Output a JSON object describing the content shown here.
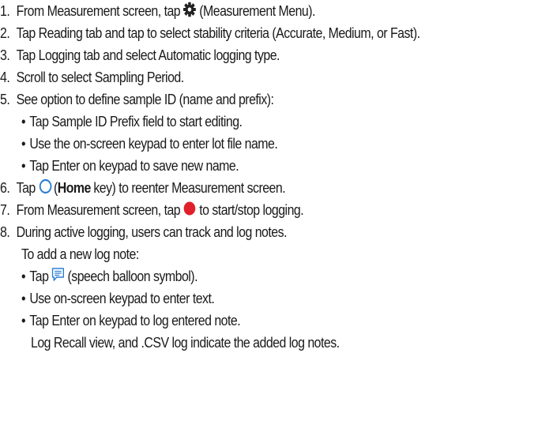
{
  "colors": {
    "text": "#1a1a1a",
    "accent_blue": "#2b7fd4",
    "record_red": "#e0202a",
    "icon_dark": "#222222"
  },
  "icons": {
    "gear": "gear-icon",
    "home": "home-circle-icon",
    "record": "record-dot-icon",
    "note": "speech-balloon-icon"
  },
  "steps": [
    {
      "num": "1.",
      "pre": "From Measurement screen, tap",
      "post": "(Measurement Menu)."
    },
    {
      "num": "2.",
      "text": "Tap Reading tab and tap to select stability criteria (Accurate, Medium, or Fast)."
    },
    {
      "num": "3.",
      "text": "Tap Logging tab and select Automatic logging type."
    },
    {
      "num": "4.",
      "text": "Scroll to select Sampling Period."
    },
    {
      "num": "5.",
      "text": "See option to define sample ID (name and prefix):"
    },
    {
      "num": "6.",
      "pre": "Tap",
      "bold": "Home",
      "post1": "(",
      "post2": "key) to reenter Measurement screen."
    },
    {
      "num": "7.",
      "pre": "From Measurement screen, tap",
      "post": "to start/stop logging."
    },
    {
      "num": "8.",
      "text": "During active logging, users can track and log notes.",
      "cont": "To add a new log note:"
    }
  ],
  "step5_bullets": [
    "Tap Sample ID Prefix field to start editing.",
    "Use the on-screen keypad to enter lot file name.",
    "Tap Enter on keypad to save new name."
  ],
  "step8_bullets": [
    {
      "pre": "Tap",
      "post": "(speech balloon symbol)."
    },
    {
      "text": "Use on-screen keypad to enter text."
    },
    {
      "text": "Tap Enter on keypad to log entered note."
    }
  ],
  "step8_tail": "Log Recall view, and .CSV log indicate the added log notes.",
  "bullet_char": "•"
}
